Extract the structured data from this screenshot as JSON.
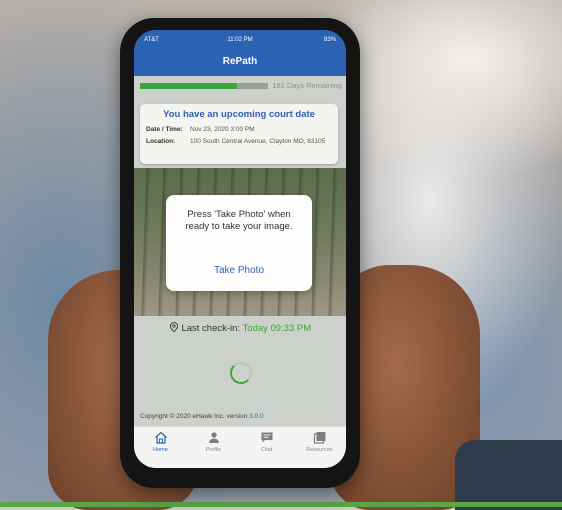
{
  "status_bar": {
    "carrier": "AT&T",
    "time": "11:02 PM",
    "battery": "83%"
  },
  "app": {
    "title": "RePath"
  },
  "progress": {
    "fraction": 0.76,
    "label": "181 Days Remaining"
  },
  "court_card": {
    "title": "You have an upcoming court date",
    "date_key": "Date / Time:",
    "date_value": "Nov 23, 2020 3:00 PM",
    "location_key": "Location:",
    "location_value": "100 South Central Avenue, Clayton MO, 63105"
  },
  "prompt": {
    "message": "Press 'Take Photo' when ready to take your image.",
    "button_label": "Take Photo"
  },
  "checkin": {
    "label": "Last check-in:",
    "value": "Today 09:33 PM"
  },
  "footer": {
    "copyright": "Copyright © 2020 eHawk Inc. version",
    "version": "3.0.0"
  },
  "tabs": [
    {
      "label": "Home",
      "icon": "home-icon",
      "active": true
    },
    {
      "label": "Profile",
      "icon": "user-icon",
      "active": false
    },
    {
      "label": "Chat",
      "icon": "chat-icon",
      "active": false
    },
    {
      "label": "Resources",
      "icon": "resources-icon",
      "active": false
    }
  ],
  "colors": {
    "primary": "#2c62b4",
    "accent_green": "#3aa43f"
  }
}
